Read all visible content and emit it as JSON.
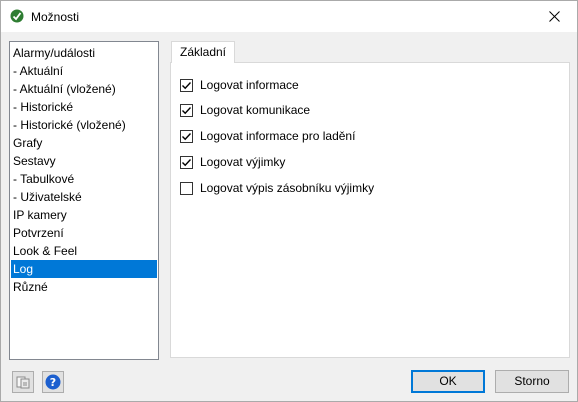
{
  "window": {
    "title": "Možnosti"
  },
  "categories": [
    {
      "label": "Alarmy/události",
      "selected": false
    },
    {
      "label": " - Aktuální",
      "selected": false
    },
    {
      "label": " - Aktuální (vložené)",
      "selected": false
    },
    {
      "label": " - Historické",
      "selected": false
    },
    {
      "label": " - Historické (vložené)",
      "selected": false
    },
    {
      "label": "Grafy",
      "selected": false
    },
    {
      "label": "Sestavy",
      "selected": false
    },
    {
      "label": " - Tabulkové",
      "selected": false
    },
    {
      "label": " - Uživatelské",
      "selected": false
    },
    {
      "label": "IP kamery",
      "selected": false
    },
    {
      "label": "Potvrzení",
      "selected": false
    },
    {
      "label": "Look & Feel",
      "selected": false
    },
    {
      "label": "Log",
      "selected": true
    },
    {
      "label": "Různé",
      "selected": false
    }
  ],
  "tabs": [
    {
      "label": "Základní",
      "active": true
    }
  ],
  "options": [
    {
      "label": "Logovat informace",
      "checked": true
    },
    {
      "label": "Logovat komunikace",
      "checked": true
    },
    {
      "label": "Logovat informace pro ladění",
      "checked": true
    },
    {
      "label": "Logovat výjimky",
      "checked": true
    },
    {
      "label": "Logovat výpis zásobníku výjimky",
      "checked": false
    }
  ],
  "buttons": {
    "ok_label": "OK",
    "cancel_label": "Storno"
  },
  "colors": {
    "selection": "#0078d7",
    "help_icon": "#1c5fcf"
  }
}
